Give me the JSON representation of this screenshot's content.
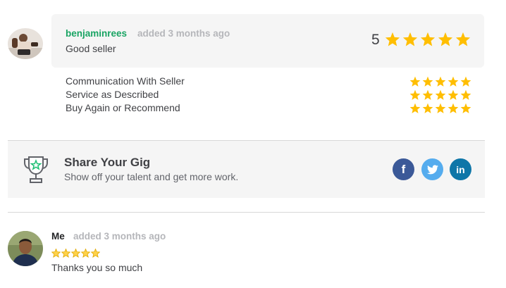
{
  "review1": {
    "username": "benjaminrees",
    "meta": "added 3 months ago",
    "text": "Good seller",
    "score": "5",
    "stars": 5,
    "star_color": "#ffbe00",
    "breakdown": [
      {
        "label": "Communication With Seller",
        "stars": 5
      },
      {
        "label": "Service as Described",
        "stars": 5
      },
      {
        "label": "Buy Again or Recommend",
        "stars": 5
      }
    ]
  },
  "share": {
    "title": "Share Your Gig",
    "subtitle": "Show off your talent and get more work.",
    "icon": "trophy-icon",
    "social": [
      {
        "name": "facebook",
        "glyph": "f",
        "color": "#3b5998"
      },
      {
        "name": "twitter",
        "glyph": "twitter",
        "color": "#55acee"
      },
      {
        "name": "linkedin",
        "glyph": "in",
        "color": "#0e76a8"
      }
    ]
  },
  "review2": {
    "username": "Me",
    "meta": "added 3 months ago",
    "stars": 5,
    "text": "Thanks you so much"
  },
  "colors": {
    "accent_green": "#1dbf73",
    "panel_bg": "#f5f5f5"
  }
}
